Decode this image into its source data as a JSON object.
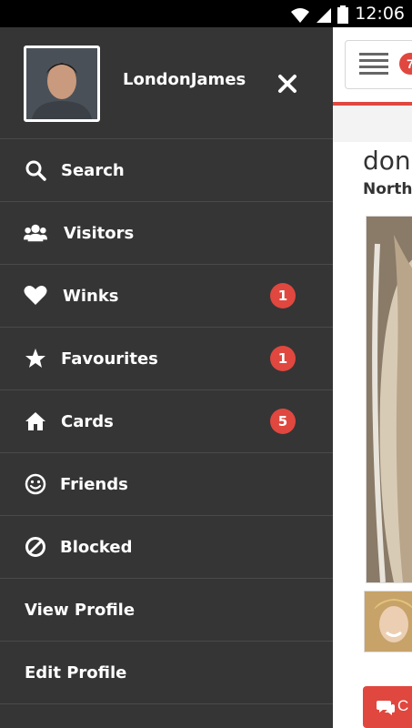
{
  "status_bar": {
    "time": "12:06"
  },
  "drawer": {
    "username": "LondonJames",
    "items": [
      {
        "label": "Search",
        "icon": "search-icon"
      },
      {
        "label": "Visitors",
        "icon": "users-icon"
      },
      {
        "label": "Winks",
        "icon": "heart-icon",
        "badge": "1"
      },
      {
        "label": "Favourites",
        "icon": "star-icon",
        "badge": "1"
      },
      {
        "label": "Cards",
        "icon": "home-icon",
        "badge": "5"
      },
      {
        "label": "Friends",
        "icon": "smiley-icon"
      },
      {
        "label": "Blocked",
        "icon": "blocked-icon"
      },
      {
        "label": "View Profile"
      },
      {
        "label": "Edit Profile"
      }
    ]
  },
  "main": {
    "menu_count": "7",
    "profile_name": "don!",
    "profile_location": "North",
    "chat_label": "C"
  },
  "colors": {
    "accent": "#e0473f",
    "drawer_bg": "#353535"
  }
}
